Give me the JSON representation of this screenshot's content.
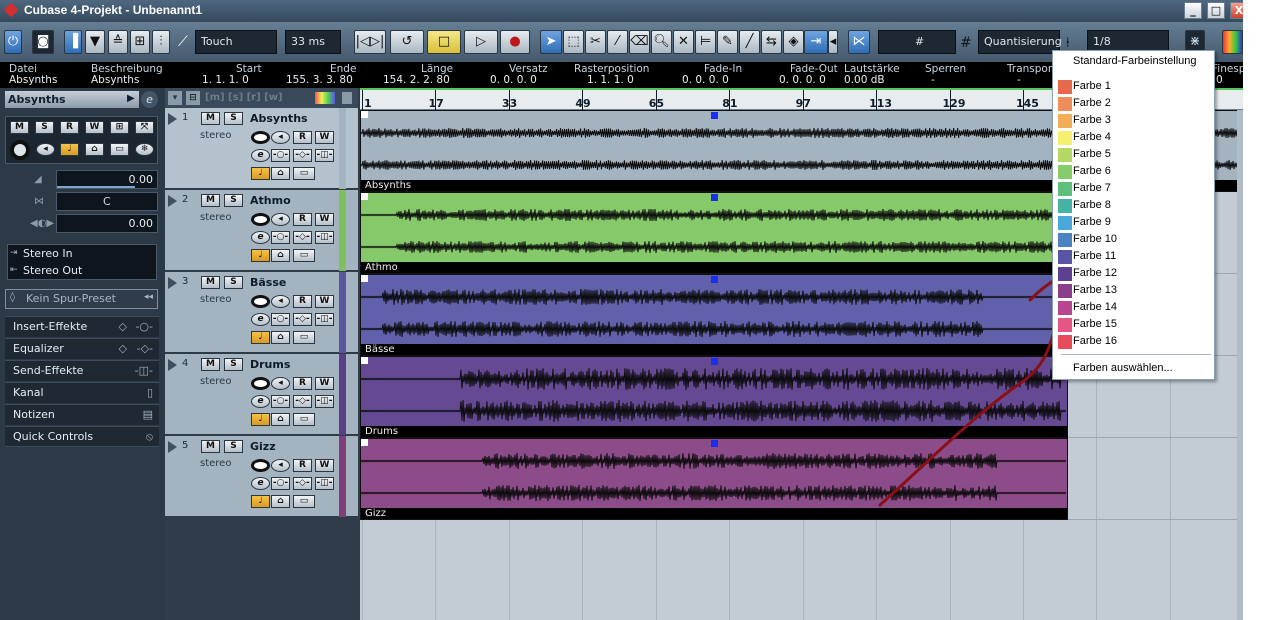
{
  "window": {
    "title": "Cubase 4-Projekt - Unbenannt1",
    "minimize": "_",
    "maximize": "□",
    "close": "X"
  },
  "toolbar": {
    "automation_mode": "Touch",
    "latency": "33 ms",
    "grid_symbol": "#",
    "quantize_label": "Quantisierung",
    "quantize_value": "1/8"
  },
  "infoline": {
    "columns": [
      "Datei",
      "Beschreibung",
      "Start",
      "Ende",
      "Länge",
      "Versatz",
      "Rasterposition",
      "Fade-In",
      "Fade-Out",
      "Lautstärke",
      "Sperren",
      "Transpon",
      "Finesponsi"
    ],
    "values": [
      "Absynths",
      "Absynths",
      "1. 1. 1. 0",
      "155. 3. 3. 80",
      "154. 2. 2. 80",
      "0. 0. 0. 0",
      "1. 1. 1. 0",
      "0. 0. 0. 0",
      "0. 0. 0. 0",
      "0.00 dB",
      "-",
      "-",
      "0"
    ]
  },
  "inspector": {
    "track_name": "Absynths",
    "volume": "0.00",
    "pan": "C",
    "delay": "0.00",
    "input": "Stereo In",
    "output": "Stereo Out",
    "preset": "Kein Spur-Preset",
    "sections": [
      "Insert-Effekte",
      "Equalizer",
      "Send-Effekte",
      "Kanal",
      "Notizen",
      "Quick Controls"
    ],
    "buttons": {
      "mute": "M",
      "solo": "S",
      "read": "R",
      "write": "W"
    }
  },
  "tracks": [
    {
      "num": "1",
      "name": "Absynths",
      "sub": "stereo",
      "color": "#a4b3c0",
      "event_color": "#a4b3c0"
    },
    {
      "num": "2",
      "name": "Athmo",
      "sub": "stereo",
      "color": "#7ec05e",
      "event_color": "#86c96a"
    },
    {
      "num": "3",
      "name": "Bässe",
      "sub": "stereo",
      "color": "#5b56a0",
      "event_color": "#6160aa"
    },
    {
      "num": "4",
      "name": "Drums",
      "sub": "stereo",
      "color": "#5b3f86",
      "event_color": "#654a93"
    },
    {
      "num": "5",
      "name": "Gizz",
      "sub": "stereo",
      "color": "#7e3f7a",
      "event_color": "#8c4b89"
    }
  ],
  "ruler": {
    "ticks": [
      "1",
      "17",
      "33",
      "49",
      "65",
      "81",
      "97",
      "113",
      "129",
      "145"
    ]
  },
  "color_menu": {
    "header": "Standard-Farbeinstellung",
    "items": [
      {
        "label": "Farbe 1",
        "color": "#e8684a"
      },
      {
        "label": "Farbe 2",
        "color": "#ef8e5a"
      },
      {
        "label": "Farbe 3",
        "color": "#f1ad58"
      },
      {
        "label": "Farbe 4",
        "color": "#f6f070"
      },
      {
        "label": "Farbe 5",
        "color": "#b3d964"
      },
      {
        "label": "Farbe 6",
        "color": "#86cc6a"
      },
      {
        "label": "Farbe 7",
        "color": "#5fbf7c"
      },
      {
        "label": "Farbe 8",
        "color": "#45b3a3"
      },
      {
        "label": "Farbe 9",
        "color": "#4aa7dc"
      },
      {
        "label": "Farbe 10",
        "color": "#4c83c0"
      },
      {
        "label": "Farbe 11",
        "color": "#5a55a3"
      },
      {
        "label": "Farbe 12",
        "color": "#5e4090"
      },
      {
        "label": "Farbe 13",
        "color": "#8a3f8a"
      },
      {
        "label": "Farbe 14",
        "color": "#b8468f"
      },
      {
        "label": "Farbe 15",
        "color": "#e75683"
      },
      {
        "label": "Farbe 16",
        "color": "#e84b5a"
      }
    ],
    "footer": "Farben auswählen..."
  }
}
